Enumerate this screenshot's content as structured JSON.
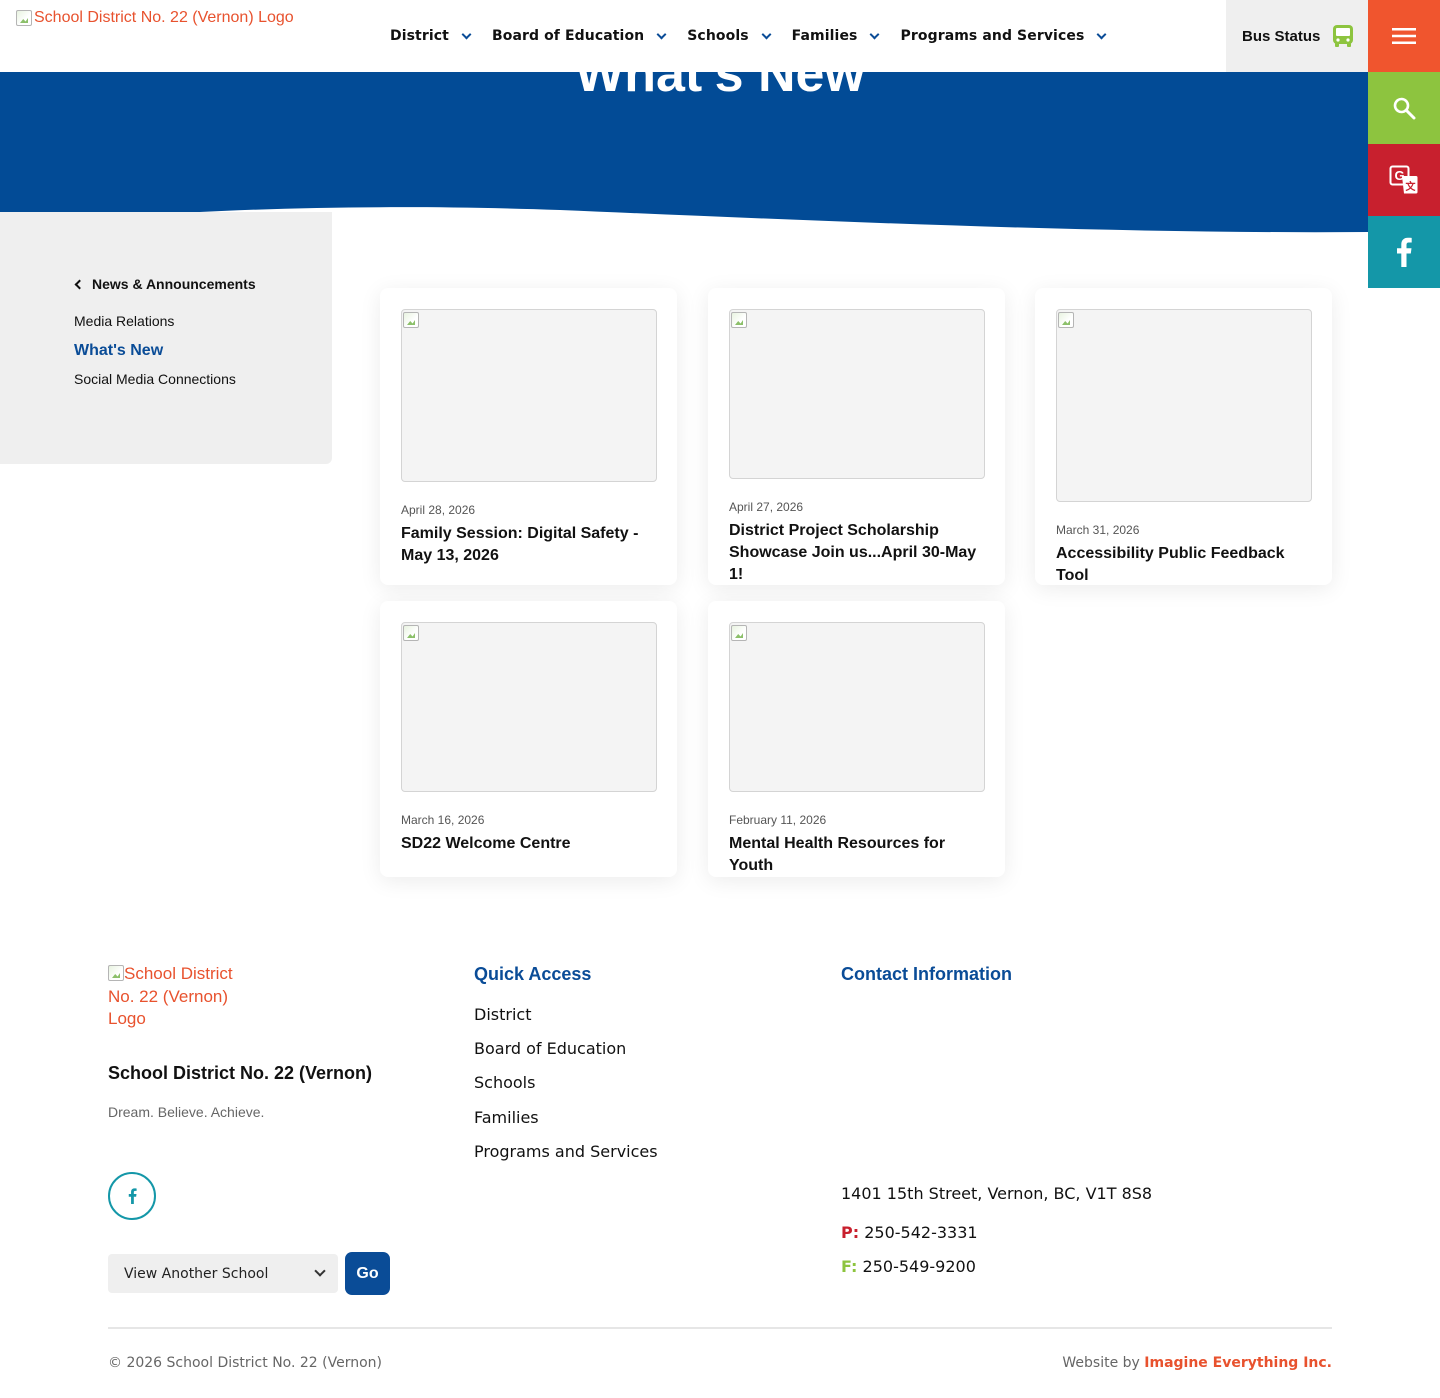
{
  "header": {
    "logo_alt": "School District No. 22 (Vernon) Logo",
    "nav": [
      "District",
      "Board of Education",
      "Schools",
      "Families",
      "Programs and Services"
    ],
    "bus_status": "Bus Status",
    "icons": {
      "bus": "bus-icon",
      "menu": "hamburger-menu-icon",
      "search": "search-icon",
      "translate": "translate-icon",
      "facebook": "facebook-icon"
    }
  },
  "colors": {
    "brand_blue": "#0a4c97",
    "menu": "#f0552e",
    "search": "#8dc43f",
    "translate": "#c8202e",
    "facebook": "#1497a8",
    "accent_orange": "#e8522e"
  },
  "banner": {
    "title": "What's New"
  },
  "sidebar": {
    "parent": "News & Announcements",
    "items": [
      "Media Relations",
      "What's New",
      "Social Media Connections"
    ],
    "active": "What's New"
  },
  "cards": [
    {
      "date": "April 28, 2026",
      "title": "Family Session: Digital Safety - May 13, 2026"
    },
    {
      "date": "April 27, 2026",
      "title": "District Project Scholarship Showcase Join us...April 30-May 1!"
    },
    {
      "date": "March 31, 2026",
      "title": "Accessibility Public Feedback Tool"
    },
    {
      "date": "March 16, 2026",
      "title": "SD22 Welcome Centre"
    },
    {
      "date": "February 11, 2026",
      "title": "Mental Health Resources for Youth"
    }
  ],
  "footer": {
    "logo_alt": "School District No. 22 (Vernon) Logo",
    "name": "School District No. 22 (Vernon)",
    "tagline": "Dream. Believe. Achieve.",
    "school_select": "View Another School",
    "go_label": "Go",
    "quick_access_heading": "Quick Access",
    "quick_links": [
      "District",
      "Board of Education",
      "Schools",
      "Families",
      "Programs and Services"
    ],
    "contact_heading": "Contact Information",
    "address": "1401 15th Street, Vernon, BC, V1T 8S8",
    "phone_label": "P:",
    "phone": "250-542-3331",
    "fax_label": "F:",
    "fax": "250-549-9200",
    "copyright": "© 2026 School District No. 22 (Vernon)",
    "credit_prefix": "Website by",
    "credit_link": "Imagine Everything Inc."
  }
}
